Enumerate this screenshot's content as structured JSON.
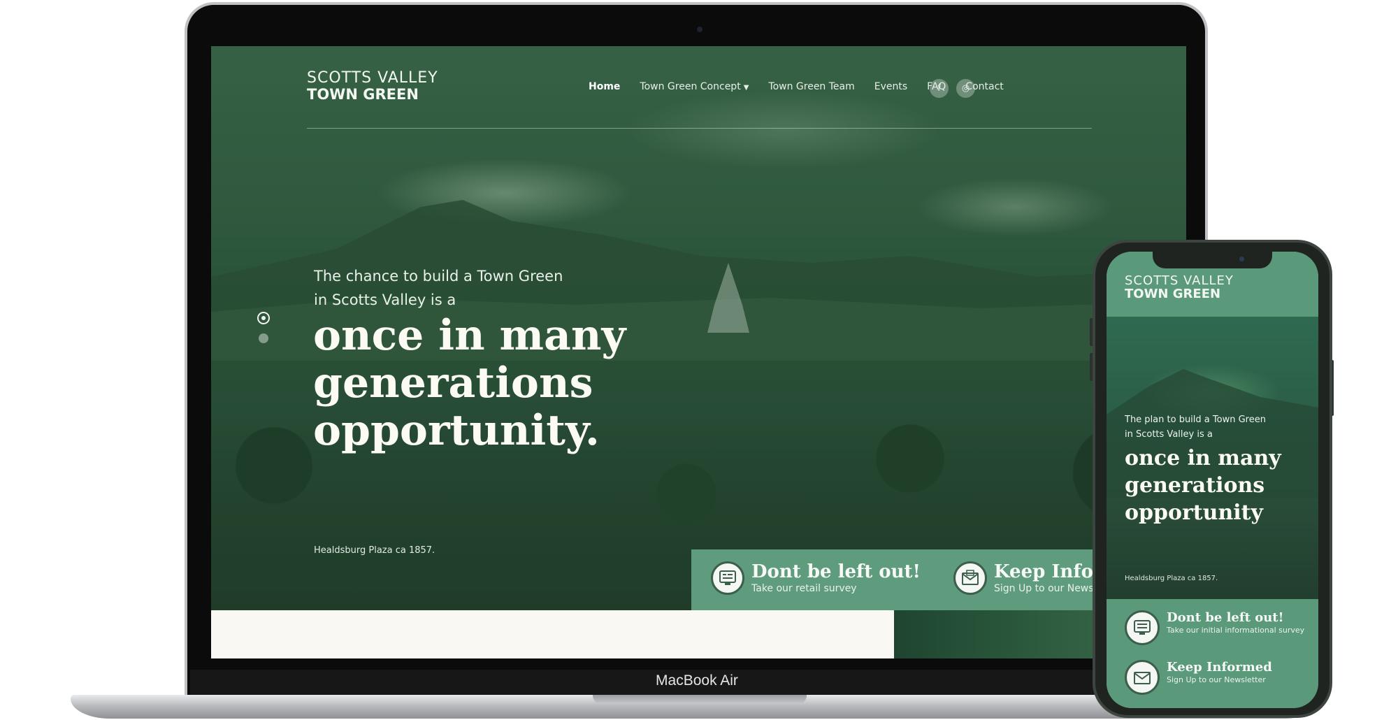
{
  "laptop": {
    "model_label": "MacBook Air",
    "site": {
      "logo": {
        "line1": "SCOTTS VALLEY",
        "line2": "TOWN GREEN"
      },
      "nav": [
        {
          "label": "Home"
        },
        {
          "label": "Town Green Concept"
        },
        {
          "label": "Town Green Team"
        },
        {
          "label": "Events"
        },
        {
          "label": "FAQ"
        },
        {
          "label": "Contact"
        }
      ],
      "social": {
        "facebook": "f",
        "instagram": "◎"
      },
      "hero": {
        "intro_line1": "The chance to build a Town Green",
        "intro_line2": "in Scotts Valley is a",
        "headline_line1": "once in many",
        "headline_line2": "generations",
        "headline_line3": "opportunity.",
        "caption": "Healdsburg Plaza ca 1857."
      },
      "cta": [
        {
          "title": "Dont be left out!",
          "subtitle": "Take our retail survey"
        },
        {
          "title": "Keep Informed",
          "subtitle": "Sign Up to our Newsletter"
        }
      ]
    }
  },
  "phone": {
    "site": {
      "logo": {
        "line1": "SCOTTS VALLEY",
        "line2": "TOWN GREEN"
      },
      "hero": {
        "intro_line1": "The plan to build a Town Green",
        "intro_line2": "in Scotts Valley is a",
        "headline_line1": "once in many",
        "headline_line2": "generations",
        "headline_line3": "opportunity",
        "caption": "Healdsburg Plaza  ca 1857."
      },
      "cta": [
        {
          "title": "Dont be left out!",
          "subtitle": "Take our initial informational survey"
        },
        {
          "title": "Keep Informed",
          "subtitle": "Sign Up to our Newsletter"
        }
      ]
    }
  },
  "colors": {
    "brand_green": "#5f9c7d",
    "hero_green": "#2e5a40",
    "cream": "#f9f8f3"
  }
}
